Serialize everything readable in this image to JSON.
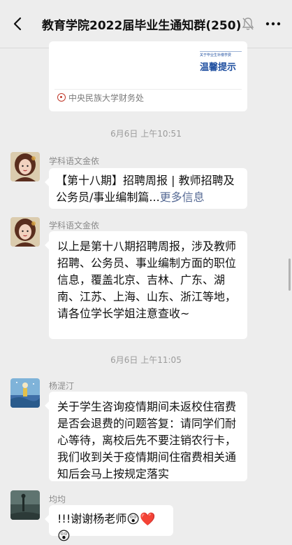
{
  "header": {
    "title": "教育学院2022届毕业生通知群(250)"
  },
  "link_card": {
    "thumb_small_text": "关于毕业生补缴学费",
    "thumb_big_text": "温馨提示",
    "source": "中央民族大学财务处"
  },
  "timestamps": [
    "6月6日 上午10:51",
    "6月6日 上午11:05"
  ],
  "messages": [
    {
      "sender": "学科语文金依",
      "text": "【第十八期】招聘周报 | 教师招聘及公务员/事业编制篇...",
      "more": "更多信息"
    },
    {
      "sender": "学科语文金依",
      "text": "以上是第十八期招聘周报，涉及教师招聘、公务员、事业编制方面的职位信息，覆盖北京、吉林、广东、湖南、江苏、上海、山东、浙江等地，请各位学长学姐注意查收~"
    },
    {
      "sender": "杨湜汀",
      "text": "关于学生咨询疫情期间未返校住宿费是否会退费的问题答复：请同学们耐心等待，离校后先不要注销农行卡，我们收到关于疫情期间住宿费相关通知后会马上按规定落实"
    },
    {
      "sender": "均均",
      "text": "!!!谢谢杨老师",
      "emojis": [
        "😲",
        "❤️",
        "😲"
      ]
    }
  ],
  "colors": {
    "background": "#ededed",
    "bubble": "#ffffff",
    "link": "#576b95"
  }
}
